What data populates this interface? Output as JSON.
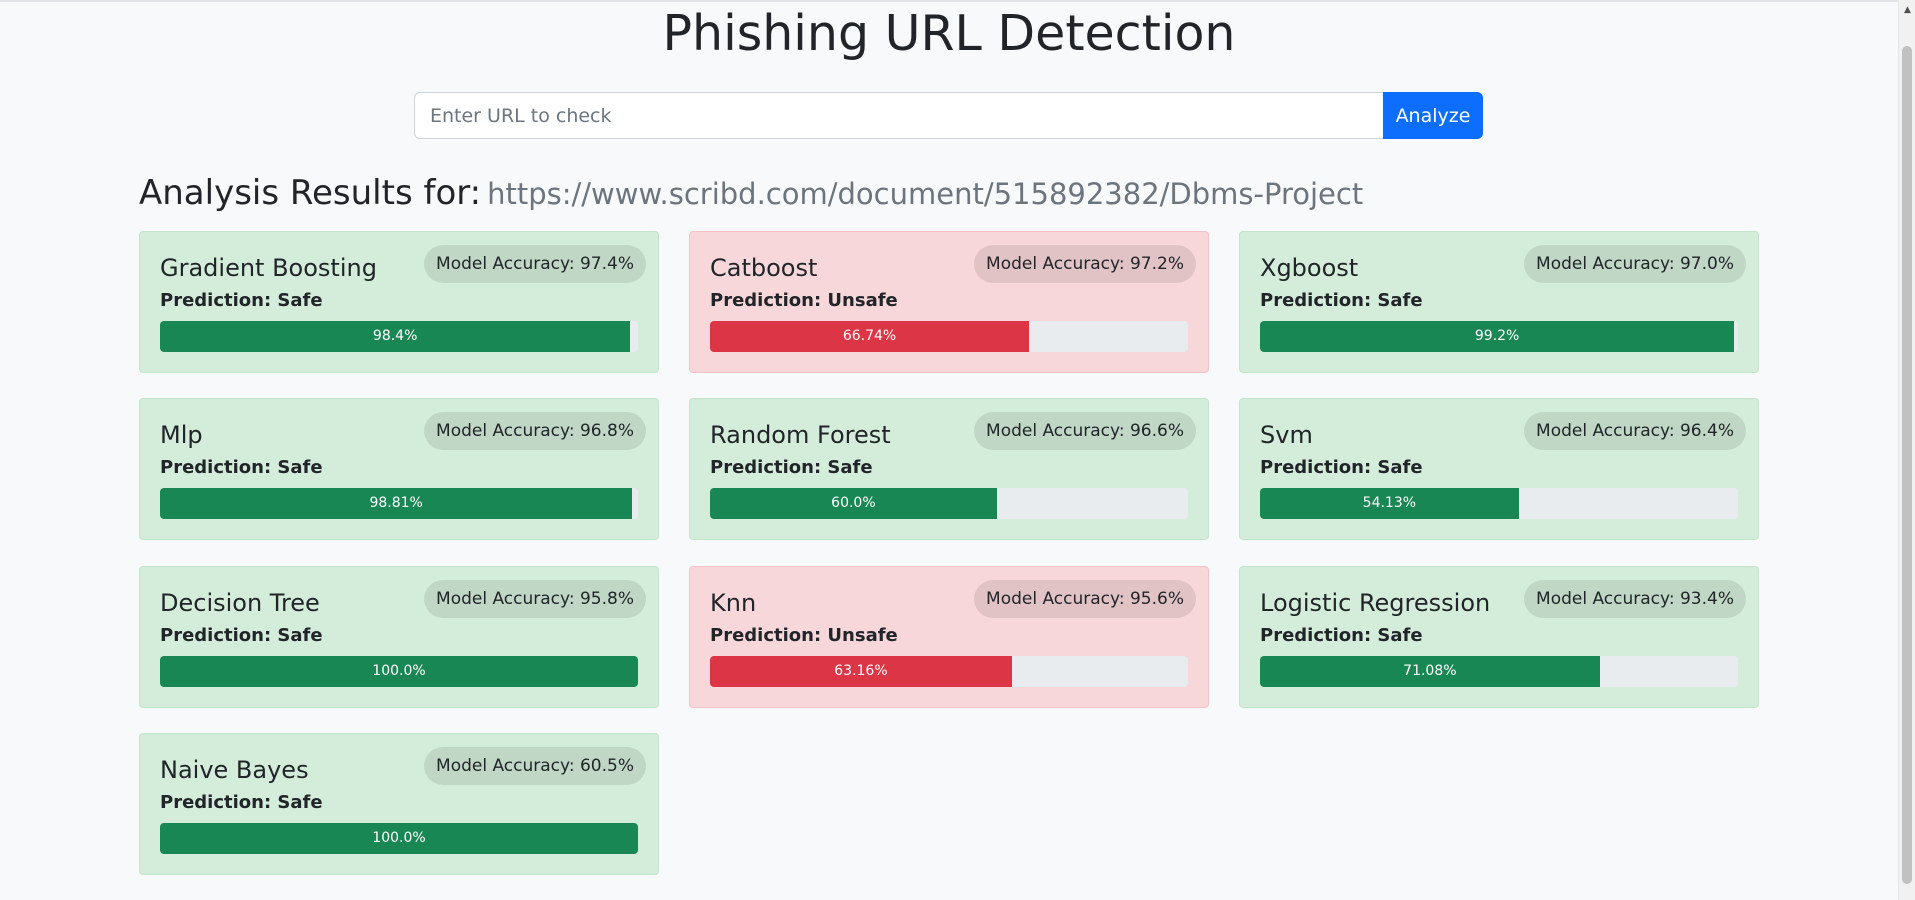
{
  "page": {
    "title": "Phishing URL Detection"
  },
  "search": {
    "placeholder": "Enter URL to check",
    "value": "",
    "button_label": "Analyze"
  },
  "results": {
    "heading": "Analysis Results for:",
    "url": "https://www.scribd.com/document/515892382/Dbms-Project"
  },
  "models": [
    {
      "name": "Gradient Boosting",
      "accuracy": "Model Accuracy: 97.4%",
      "prediction": "Prediction: Safe",
      "status": "safe",
      "confidence": 98.4,
      "confidence_label": "98.4%"
    },
    {
      "name": "Catboost",
      "accuracy": "Model Accuracy: 97.2%",
      "prediction": "Prediction: Unsafe",
      "status": "unsafe",
      "confidence": 66.74,
      "confidence_label": "66.74%"
    },
    {
      "name": "Xgboost",
      "accuracy": "Model Accuracy: 97.0%",
      "prediction": "Prediction: Safe",
      "status": "safe",
      "confidence": 99.2,
      "confidence_label": "99.2%"
    },
    {
      "name": "Mlp",
      "accuracy": "Model Accuracy: 96.8%",
      "prediction": "Prediction: Safe",
      "status": "safe",
      "confidence": 98.81,
      "confidence_label": "98.81%"
    },
    {
      "name": "Random Forest",
      "accuracy": "Model Accuracy: 96.6%",
      "prediction": "Prediction: Safe",
      "status": "safe",
      "confidence": 60.0,
      "confidence_label": "60.0%"
    },
    {
      "name": "Svm",
      "accuracy": "Model Accuracy: 96.4%",
      "prediction": "Prediction: Safe",
      "status": "safe",
      "confidence": 54.13,
      "confidence_label": "54.13%"
    },
    {
      "name": "Decision Tree",
      "accuracy": "Model Accuracy: 95.8%",
      "prediction": "Prediction: Safe",
      "status": "safe",
      "confidence": 100.0,
      "confidence_label": "100.0%"
    },
    {
      "name": "Knn",
      "accuracy": "Model Accuracy: 95.6%",
      "prediction": "Prediction: Unsafe",
      "status": "unsafe",
      "confidence": 63.16,
      "confidence_label": "63.16%"
    },
    {
      "name": "Logistic Regression",
      "accuracy": "Model Accuracy: 93.4%",
      "prediction": "Prediction: Safe",
      "status": "safe",
      "confidence": 71.08,
      "confidence_label": "71.08%"
    },
    {
      "name": "Naive Bayes",
      "accuracy": "Model Accuracy: 60.5%",
      "prediction": "Prediction: Safe",
      "status": "safe",
      "confidence": 100.0,
      "confidence_label": "100.0%"
    }
  ],
  "colors": {
    "primary": "#0d6efd",
    "safe_bar": "#198754",
    "unsafe_bar": "#dc3545",
    "safe_card": "#d4edda",
    "unsafe_card": "#f8d7da"
  },
  "icons": {
    "scroll_up": "scroll-up-arrow-icon"
  }
}
